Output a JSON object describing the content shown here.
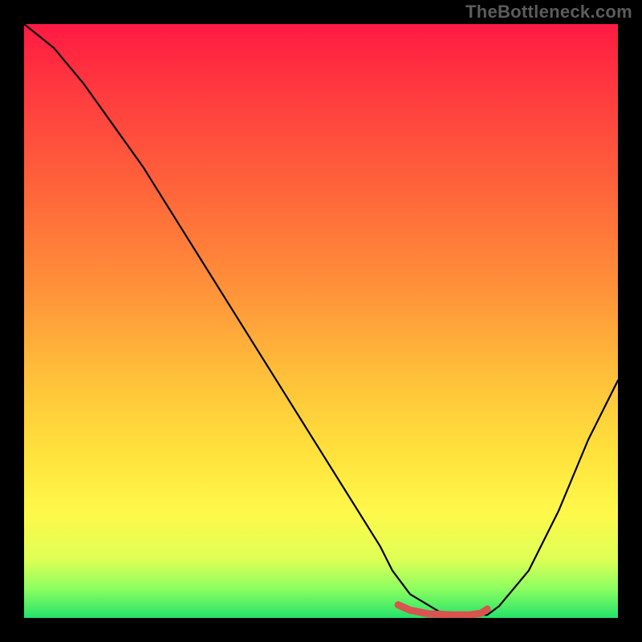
{
  "watermark": "TheBottleneck.com",
  "chart_data": {
    "type": "line",
    "title": "",
    "xlabel": "",
    "ylabel": "",
    "xlim": [
      0,
      100
    ],
    "ylim": [
      0,
      100
    ],
    "series": [
      {
        "name": "bottleneck-curve",
        "x": [
          0,
          5,
          10,
          15,
          20,
          25,
          30,
          35,
          40,
          45,
          50,
          55,
          60,
          62,
          65,
          70,
          75,
          78,
          80,
          85,
          90,
          95,
          100
        ],
        "y": [
          100,
          96,
          90,
          83,
          76,
          68,
          60,
          52,
          44,
          36,
          28,
          20,
          12,
          8,
          4,
          1,
          0.5,
          0.5,
          2,
          8,
          18,
          30,
          40
        ]
      },
      {
        "name": "optimal-band",
        "x": [
          63,
          65,
          68,
          72,
          75,
          77,
          78
        ],
        "y": [
          2.2,
          1.3,
          0.7,
          0.5,
          0.5,
          0.8,
          1.5
        ]
      }
    ],
    "colors": {
      "curve": "#000000",
      "optimal_band": "#d9534f",
      "gradient_top": "#ff1a42",
      "gradient_mid1": "#ff933a",
      "gradient_mid2": "#fff84a",
      "gradient_bottom": "#24e36a"
    }
  }
}
